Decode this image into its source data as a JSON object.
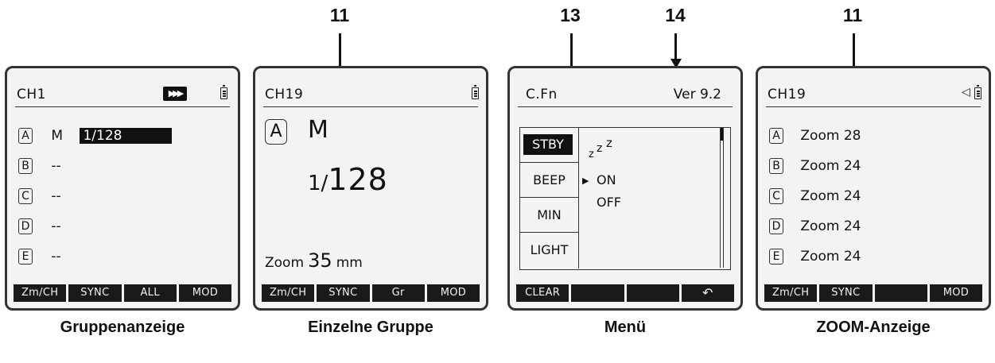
{
  "callouts": {
    "n1": "11",
    "n2": "13",
    "n3": "14",
    "n4": "11"
  },
  "captions": [
    "Gruppenanzeige",
    "Einzelne Gruppe",
    "Menü",
    "ZOOM-Anzeige"
  ],
  "screen1": {
    "channel": "CH1",
    "icons": [
      "fast-forward-icon",
      "battery-icon"
    ],
    "groups": [
      {
        "letter": "A",
        "mode": "M",
        "value": "1/128"
      },
      {
        "letter": "B",
        "mode": "--",
        "value": ""
      },
      {
        "letter": "C",
        "mode": "--",
        "value": ""
      },
      {
        "letter": "D",
        "mode": "--",
        "value": ""
      },
      {
        "letter": "E",
        "mode": "--",
        "value": ""
      }
    ],
    "footer": [
      "Zm/CH",
      "SYNC",
      "ALL",
      "MOD"
    ]
  },
  "screen2": {
    "channel": "CH19",
    "group": "A",
    "mode": "M",
    "power_prefix": "1/",
    "power_value": "128",
    "zoom_label": "Zoom",
    "zoom_value": "35",
    "zoom_unit": "mm",
    "footer": [
      "Zm/CH",
      "SYNC",
      "Gr",
      "MOD"
    ]
  },
  "screen3": {
    "left_title": "C.Fn",
    "version": "Ver 9.2",
    "menu": [
      "STBY",
      "BEEP",
      "MIN",
      "LIGHT"
    ],
    "selected_menu": "STBY",
    "sleep_symbol": "z z z",
    "options": [
      "ON",
      "OFF"
    ],
    "selected_option": "ON",
    "footer": [
      "CLEAR",
      "",
      "",
      ""
    ],
    "back_icon": "back-arrow-icon"
  },
  "screen4": {
    "channel": "CH19",
    "icons": [
      "speaker-icon",
      "battery-icon"
    ],
    "zooms": [
      {
        "letter": "A",
        "label": "Zoom 28"
      },
      {
        "letter": "B",
        "label": "Zoom 24"
      },
      {
        "letter": "C",
        "label": "Zoom 24"
      },
      {
        "letter": "D",
        "label": "Zoom 24"
      },
      {
        "letter": "E",
        "label": "Zoom 24"
      }
    ],
    "footer": [
      "Zm/CH",
      "SYNC",
      "",
      "MOD"
    ]
  }
}
